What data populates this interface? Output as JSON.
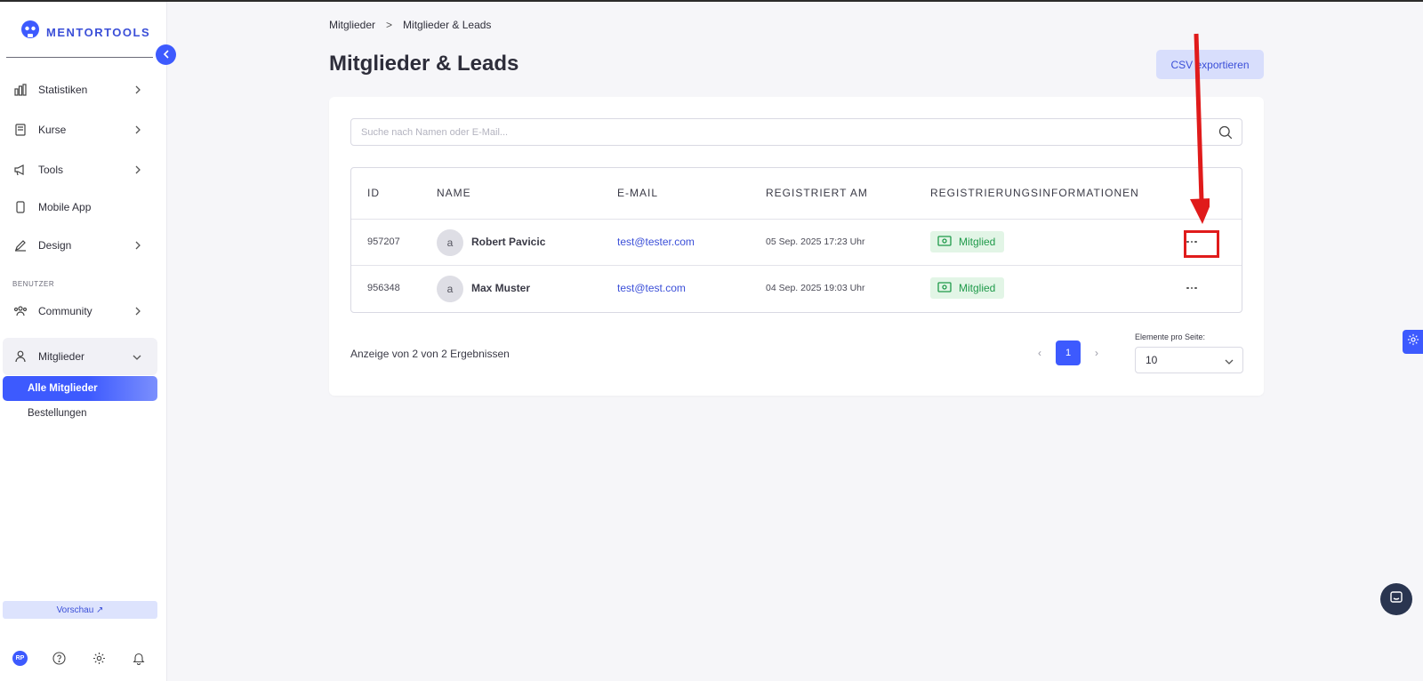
{
  "app": {
    "logo_text": "MENTORTOOLS"
  },
  "sidebar": {
    "items": [
      {
        "label": "Statistiken"
      },
      {
        "label": "Kurse"
      },
      {
        "label": "Tools"
      },
      {
        "label": "Mobile App"
      },
      {
        "label": "Design"
      }
    ],
    "section_label": "BENUTZER",
    "community_label": "Community",
    "members_label": "Mitglieder",
    "sub_items": [
      {
        "label": "Alle Mitglieder"
      },
      {
        "label": "Bestellungen"
      }
    ],
    "preview_label": "Vorschau ↗",
    "user_initials": "RP"
  },
  "breadcrumb": {
    "root": "Mitglieder",
    "separator": ">",
    "current": "Mitglieder & Leads"
  },
  "page": {
    "title": "Mitglieder & Leads",
    "export_label": "CSV exportieren"
  },
  "search": {
    "placeholder": "Suche nach Namen oder E-Mail...",
    "value": ""
  },
  "table": {
    "headers": {
      "id": "ID",
      "name": "NAME",
      "email": "E-MAIL",
      "registered": "REGISTRIERT AM",
      "info": "REGISTRIERUNGSINFORMATIONEN"
    },
    "rows": [
      {
        "id": "957207",
        "avatar": "a",
        "name": "Robert Pavicic",
        "email": "test@tester.com",
        "registered": "05 Sep. 2025 17:23 Uhr",
        "status": "Mitglied"
      },
      {
        "id": "956348",
        "avatar": "a",
        "name": "Max Muster",
        "email": "test@test.com",
        "registered": "04 Sep. 2025 19:03 Uhr",
        "status": "Mitglied"
      }
    ]
  },
  "pagination": {
    "summary": "Anzeige von 2 von 2 Ergebnissen",
    "current_page": "1",
    "prev": "‹",
    "next": "›",
    "per_page_label": "Elemente pro Seite:",
    "per_page_value": "10"
  },
  "colors": {
    "accent": "#3d5afe",
    "success": "#1f9a4a",
    "highlight": "#e01b1b"
  }
}
